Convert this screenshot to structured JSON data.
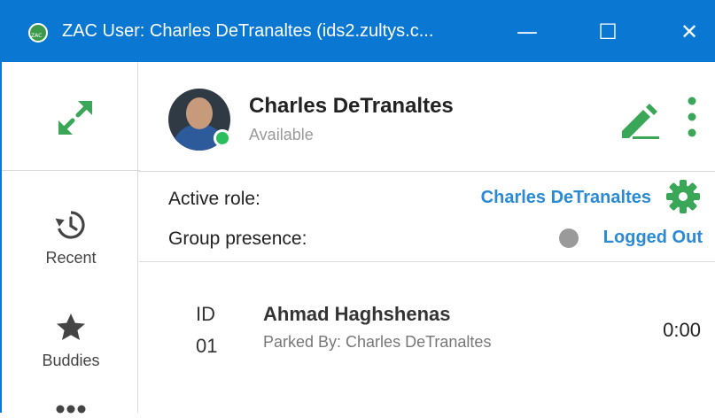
{
  "window": {
    "title": "ZAC User: Charles DeTranaltes (ids2.zultys.c...",
    "minimize": "—",
    "maximize": "☐",
    "close": "✕"
  },
  "colors": {
    "titlebar": "#0a78d2",
    "accent_green": "#3aa657",
    "link_blue": "#2a8ad4",
    "presence_available": "#2bbd5e",
    "presence_logged_out": "#9a9a9a"
  },
  "sidebar": {
    "expand_icon": "expand-arrows-icon",
    "items": [
      {
        "icon": "history-icon",
        "label": "Recent"
      },
      {
        "icon": "star-icon",
        "label": "Buddies"
      },
      {
        "icon": "more-icon",
        "label": ""
      }
    ]
  },
  "user": {
    "name": "Charles DeTranaltes",
    "status": "Available",
    "avatar_icon": "user-avatar"
  },
  "header_actions": {
    "edit_icon": "pencil-icon",
    "menu_icon": "kebab-menu-icon"
  },
  "role": {
    "label": "Active role:",
    "value": "Charles DeTranaltes",
    "settings_icon": "gear-icon"
  },
  "group_presence": {
    "label": "Group presence:",
    "value": "Logged Out"
  },
  "parked_call": {
    "id_label": "ID",
    "id_value": "01",
    "caller": "Ahmad Haghshenas",
    "parked_by": "Parked By: Charles DeTranaltes",
    "duration": "0:00"
  }
}
